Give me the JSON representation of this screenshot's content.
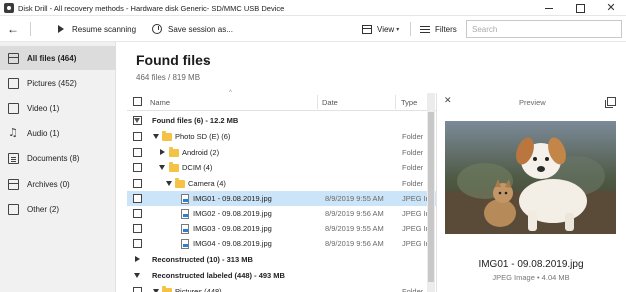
{
  "window": {
    "title": "Disk Drill - All recovery methods - Hardware disk Generic- SD/MMC USB Device",
    "close_glyph": "✕"
  },
  "toolbar": {
    "back_glyph": "←",
    "resume_label": "Resume scanning",
    "save_label": "Save session as...",
    "view_label": "View",
    "filters_label": "Filters",
    "search_placeholder": "Search"
  },
  "sidebar": {
    "items": [
      {
        "label": "All files (464)",
        "icon": "all-files-icon"
      },
      {
        "label": "Pictures (452)",
        "icon": "picture-icon"
      },
      {
        "label": "Video (1)",
        "icon": "video-icon"
      },
      {
        "label": "Audio (1)",
        "icon": "audio-icon"
      },
      {
        "label": "Documents (8)",
        "icon": "document-icon"
      },
      {
        "label": "Archives (0)",
        "icon": "archive-icon"
      },
      {
        "label": "Other (2)",
        "icon": "other-icon"
      }
    ]
  },
  "main": {
    "title": "Found files",
    "title_chevron": "⌄",
    "subtitle": "464 files / 819 MB"
  },
  "table": {
    "columns": {
      "name": "Name",
      "date": "Date",
      "type": "Type"
    },
    "rows": [
      {
        "name": "Found files (6) - 12.2 MB",
        "date": "",
        "type": ""
      },
      {
        "name": "Photo SD (E) (6)",
        "date": "",
        "type": "Folder"
      },
      {
        "name": "Android (2)",
        "date": "",
        "type": "Folder"
      },
      {
        "name": "DCIM (4)",
        "date": "",
        "type": "Folder"
      },
      {
        "name": "Camera (4)",
        "date": "",
        "type": "Folder"
      },
      {
        "name": "IMG01 - 09.08.2019.jpg",
        "date": "8/9/2019 9:55 AM",
        "type": "JPEG Ir"
      },
      {
        "name": "IMG02 - 09.08.2019.jpg",
        "date": "8/9/2019 9:56 AM",
        "type": "JPEG Ir"
      },
      {
        "name": "IMG03 - 09.08.2019.jpg",
        "date": "8/9/2019 9:55 AM",
        "type": "JPEG Ir"
      },
      {
        "name": "IMG04 - 09.08.2019.jpg",
        "date": "8/9/2019 9:56 AM",
        "type": "JPEG Ir"
      },
      {
        "name": "Reconstructed (10) - 313 MB",
        "date": "",
        "type": ""
      },
      {
        "name": "Reconstructed labeled (448) - 493 MB",
        "date": "",
        "type": ""
      },
      {
        "name": "Pictures (448)",
        "date": "",
        "type": "Folder"
      }
    ]
  },
  "preview": {
    "label": "Preview",
    "close_glyph": "✕",
    "file_name": "IMG01 - 09.08.2019.jpg",
    "file_meta": "JPEG Image • 4.04 MB"
  }
}
